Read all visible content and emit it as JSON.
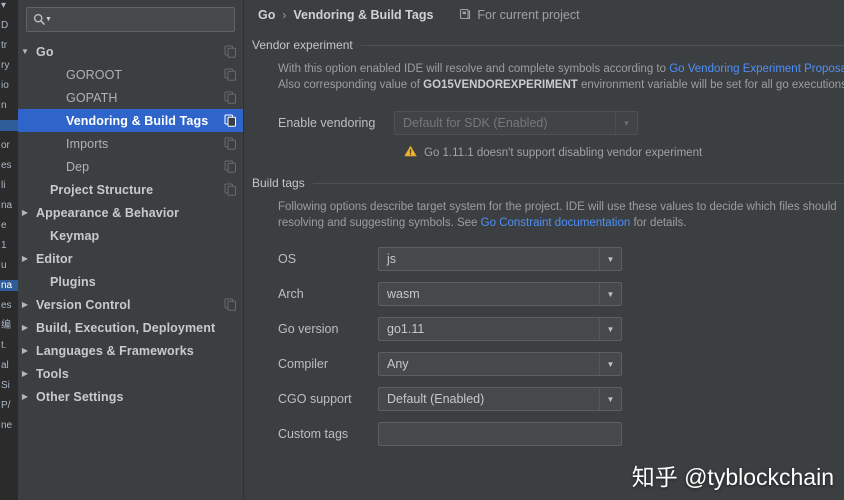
{
  "background_window": {
    "fragments": [
      "▾",
      "D",
      "tr",
      "ry",
      "io",
      "n",
      "",
      "or",
      "es",
      "li",
      "na",
      "e",
      "1",
      "u",
      "na",
      "es",
      "编",
      "t.",
      "al",
      "Si",
      "P/",
      "ne"
    ],
    "selected_indices": [
      6,
      14
    ]
  },
  "search": {
    "value": "",
    "placeholder": "",
    "icon": "search-icon",
    "dropdown_icon": "chevron-down-icon"
  },
  "sidebar": {
    "items": [
      {
        "label": "Go",
        "arrow": "expanded",
        "bold": true,
        "child": false,
        "selected": false,
        "copy_icon": true,
        "indent": 14
      },
      {
        "label": "GOROOT",
        "arrow": "none",
        "bold": false,
        "child": true,
        "selected": false,
        "copy_icon": true,
        "indent": 44
      },
      {
        "label": "GOPATH",
        "arrow": "none",
        "bold": false,
        "child": true,
        "selected": false,
        "copy_icon": true,
        "indent": 44
      },
      {
        "label": "Vendoring & Build Tags",
        "arrow": "none",
        "bold": false,
        "child": true,
        "selected": true,
        "copy_icon": true,
        "indent": 44
      },
      {
        "label": "Imports",
        "arrow": "none",
        "bold": false,
        "child": true,
        "selected": false,
        "copy_icon": true,
        "indent": 44
      },
      {
        "label": "Dep",
        "arrow": "none",
        "bold": false,
        "child": true,
        "selected": false,
        "copy_icon": true,
        "indent": 44
      },
      {
        "label": "Project Structure",
        "arrow": "none",
        "bold": true,
        "child": false,
        "selected": false,
        "copy_icon": true,
        "indent": 28
      },
      {
        "label": "Appearance & Behavior",
        "arrow": "collapsed",
        "bold": true,
        "child": false,
        "selected": false,
        "copy_icon": false,
        "indent": 14
      },
      {
        "label": "Keymap",
        "arrow": "none",
        "bold": true,
        "child": false,
        "selected": false,
        "copy_icon": false,
        "indent": 28
      },
      {
        "label": "Editor",
        "arrow": "collapsed",
        "bold": true,
        "child": false,
        "selected": false,
        "copy_icon": false,
        "indent": 14
      },
      {
        "label": "Plugins",
        "arrow": "none",
        "bold": true,
        "child": false,
        "selected": false,
        "copy_icon": false,
        "indent": 28
      },
      {
        "label": "Version Control",
        "arrow": "collapsed",
        "bold": true,
        "child": false,
        "selected": false,
        "copy_icon": true,
        "indent": 14
      },
      {
        "label": "Build, Execution, Deployment",
        "arrow": "collapsed",
        "bold": true,
        "child": false,
        "selected": false,
        "copy_icon": false,
        "indent": 14
      },
      {
        "label": "Languages & Frameworks",
        "arrow": "collapsed",
        "bold": true,
        "child": false,
        "selected": false,
        "copy_icon": false,
        "indent": 14
      },
      {
        "label": "Tools",
        "arrow": "collapsed",
        "bold": true,
        "child": false,
        "selected": false,
        "copy_icon": false,
        "indent": 14
      },
      {
        "label": "Other Settings",
        "arrow": "collapsed",
        "bold": true,
        "child": false,
        "selected": false,
        "copy_icon": false,
        "indent": 14
      }
    ]
  },
  "breadcrumb": {
    "root": "Go",
    "separator": "›",
    "current": "Vendoring & Build Tags",
    "scope_label": "For current project",
    "scope_icon": "project-scope-icon"
  },
  "vendor_section": {
    "title": "Vendor experiment",
    "desc_line1_a": "With this option enabled IDE will resolve and complete symbols according to ",
    "desc_line1_link": "Go Vendoring Experiment Proposa",
    "desc_line2_a": "Also corresponding value of ",
    "desc_line2_b": "GO15VENDOREXPERIMENT",
    "desc_line2_c": " environment variable will be set for all go executions f",
    "enable_label": "Enable vendoring",
    "enable_value": "Default for SDK (Enabled)",
    "enable_disabled": true,
    "warning_icon": "warning-triangle-icon",
    "warning_text": "Go 1.11.1 doesn't support disabling vendor experiment"
  },
  "build_tags_section": {
    "title": "Build tags",
    "desc_line1": "Following options describe target system for the project. IDE will use these values to decide which files should",
    "desc_line2_a": "resolving and suggesting symbols. See ",
    "desc_line2_link": "Go Constraint documentation",
    "desc_line2_b": " for details.",
    "fields": [
      {
        "label": "OS",
        "value": "js",
        "type": "combo"
      },
      {
        "label": "Arch",
        "value": "wasm",
        "type": "combo"
      },
      {
        "label": "Go version",
        "value": "go1.11",
        "type": "combo"
      },
      {
        "label": "Compiler",
        "value": "Any",
        "type": "combo"
      },
      {
        "label": "CGO support",
        "value": "Default (Enabled)",
        "type": "combo"
      },
      {
        "label": "Custom tags",
        "value": "",
        "type": "text"
      }
    ]
  },
  "watermark": {
    "text": "知乎 @tyblockchain"
  },
  "colors": {
    "panel_bg": "#3c3f41",
    "selection_blue": "#2f65ca",
    "link_blue": "#4f8ff7",
    "warning_amber": "#f0b73a",
    "text_primary": "#bbbbbb",
    "field_bg": "#45494a"
  }
}
